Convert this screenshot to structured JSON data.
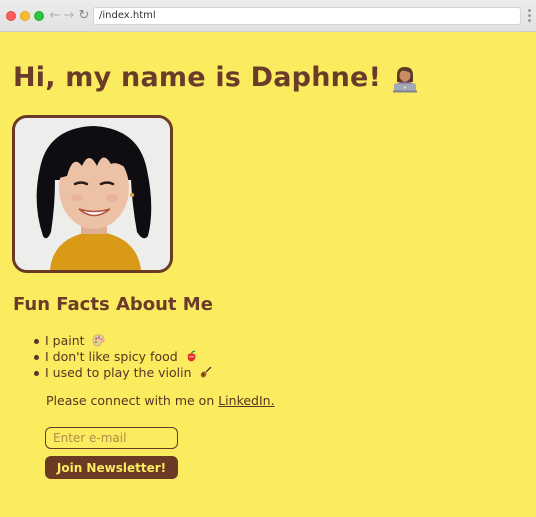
{
  "browser": {
    "url": "/index.html",
    "back_icon": "←",
    "forward_icon": "→",
    "reload_icon": "↻"
  },
  "page": {
    "heading": "Hi, my name is Daphne!",
    "heading_icon": "woman-technologist-icon",
    "photo_alt": "Daphne",
    "subheading": "Fun Facts About Me",
    "facts": [
      {
        "text": "I paint",
        "icon": "palette-icon"
      },
      {
        "text": "I don't like spicy food",
        "icon": "hot-pepper-icon"
      },
      {
        "text": "I used to play the violin",
        "icon": "violin-icon"
      }
    ],
    "connect_text": "Please connect with me on ",
    "connect_link": "LinkedIn.",
    "email_placeholder": "Enter e-mail",
    "email_value": "",
    "join_label": "Join Newsletter!"
  },
  "colors": {
    "background": "#fbeb5f",
    "accent": "#6a3a24",
    "text": "#5a3322"
  }
}
